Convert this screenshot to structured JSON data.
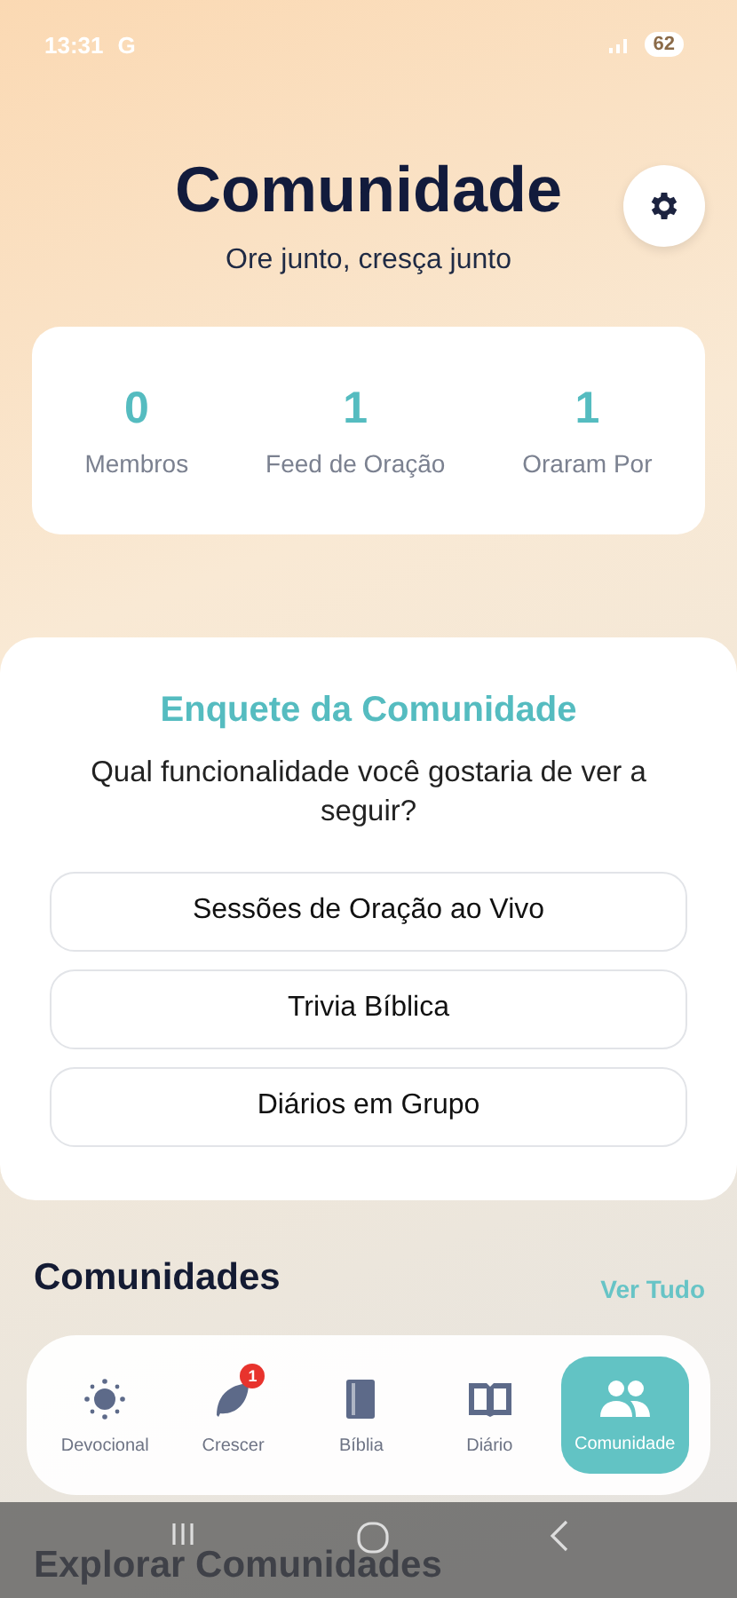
{
  "status_bar": {
    "time": "13:31",
    "network": "G",
    "battery": "62"
  },
  "header": {
    "title": "Comunidade",
    "subtitle": "Ore junto, cresça junto"
  },
  "stats": [
    {
      "value": "0",
      "label": "Membros"
    },
    {
      "value": "1",
      "label": "Feed de Oração"
    },
    {
      "value": "1",
      "label": "Oraram Por"
    }
  ],
  "poll": {
    "title": "Enquete da Comunidade",
    "question": "Qual funcionalidade você gostaria de ver a seguir?",
    "options": [
      "Sessões de Oração ao Vivo",
      "Trivia Bíblica",
      "Diários em Grupo"
    ]
  },
  "communities": {
    "title": "Comunidades",
    "link": "Ver Tudo"
  },
  "explore": {
    "title": "Explorar Comunidades"
  },
  "bottom_nav": [
    {
      "kind": "sun",
      "label": "Devocional",
      "selected": false
    },
    {
      "kind": "leaf",
      "label": "Crescer",
      "selected": false,
      "badge": "1"
    },
    {
      "kind": "book",
      "label": "Bíblia",
      "selected": false
    },
    {
      "kind": "open-book",
      "label": "Diário",
      "selected": false
    },
    {
      "kind": "people",
      "label": "Comunidade",
      "selected": true
    }
  ]
}
